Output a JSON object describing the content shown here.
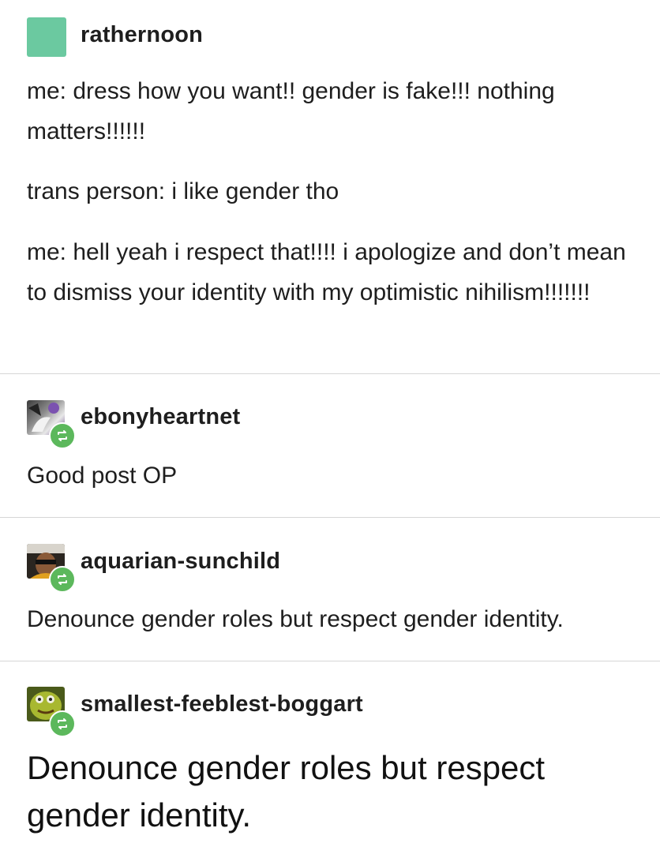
{
  "posts": [
    {
      "username": "rathernoon",
      "avatar_color": "#6bc9a0",
      "paragraphs": [
        "me: dress how you want!! gender is fake!!! nothing matters!!!!!!",
        "trans person: i like gender tho",
        "me: hell yeah i respect that!!!! i apologize and don’t mean to dismiss your identity with my optimistic nihilism!!!!!!!"
      ]
    },
    {
      "username": "ebonyheartnet",
      "text": "Good post OP"
    },
    {
      "username": "aquarian-sunchild",
      "text": "Denounce gender roles but respect gender identity."
    },
    {
      "username": "smallest-feeblest-boggart",
      "text": "Denounce gender roles but respect gender identity."
    }
  ],
  "reblog_badge_color": "#5cb85c",
  "icons": {
    "reblog": "reblog-icon"
  }
}
